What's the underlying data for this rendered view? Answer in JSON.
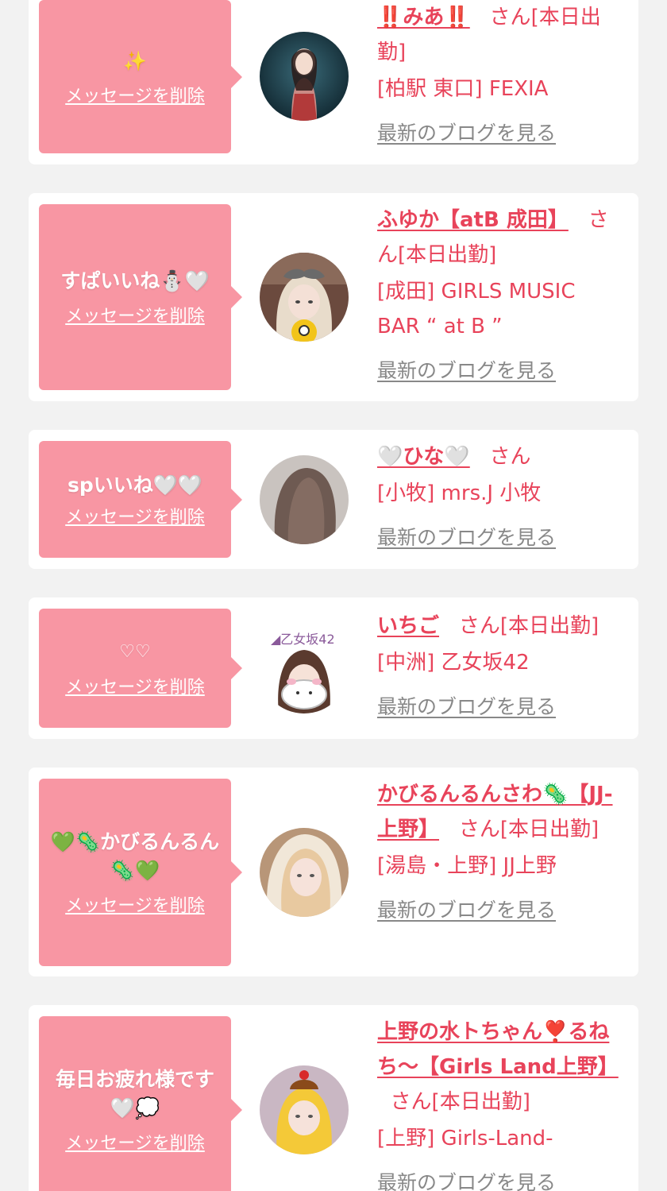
{
  "ui": {
    "delete_label": "メッセージを削除",
    "blog_label": "最新のブログを見る",
    "san_label": "さん"
  },
  "colors": {
    "bubble": "#f896a3",
    "accent": "#e8435a",
    "link_gray": "#888888",
    "background": "#f2f2f2"
  },
  "cards": [
    {
      "message": "✨",
      "name": "‼️みあ‼️",
      "status": "[本日出勤]",
      "shop": "[柏駅 東口] FEXIA"
    },
    {
      "message": "すぱいいね⛄🤍",
      "name": "ふゆか【atB 成田】",
      "status": "[本日出勤]",
      "shop": "[成田] GIRLS MUSIC BAR “ at B ”"
    },
    {
      "message": "spいいね🤍🤍",
      "name": "🤍ひな🤍",
      "status": "",
      "shop": "[小牧] mrs.J 小牧"
    },
    {
      "message": "♡♡",
      "name": "いちご",
      "status": "[本日出勤]",
      "shop": "[中洲] 乙女坂42"
    },
    {
      "message": "💚🦠かびるんるん🦠💚",
      "name": "かびるんるんさわ🦠【JJ-上野】",
      "status": "[本日出勤]",
      "shop": "[湯島・上野] JJ上野"
    },
    {
      "message": "毎日お疲れ様です🤍💭",
      "name": "上野の水トちゃん❣️るねち〜【Girls Land上野】",
      "status": "[本日出勤]",
      "shop": "[上野] Girls-Land-"
    }
  ]
}
